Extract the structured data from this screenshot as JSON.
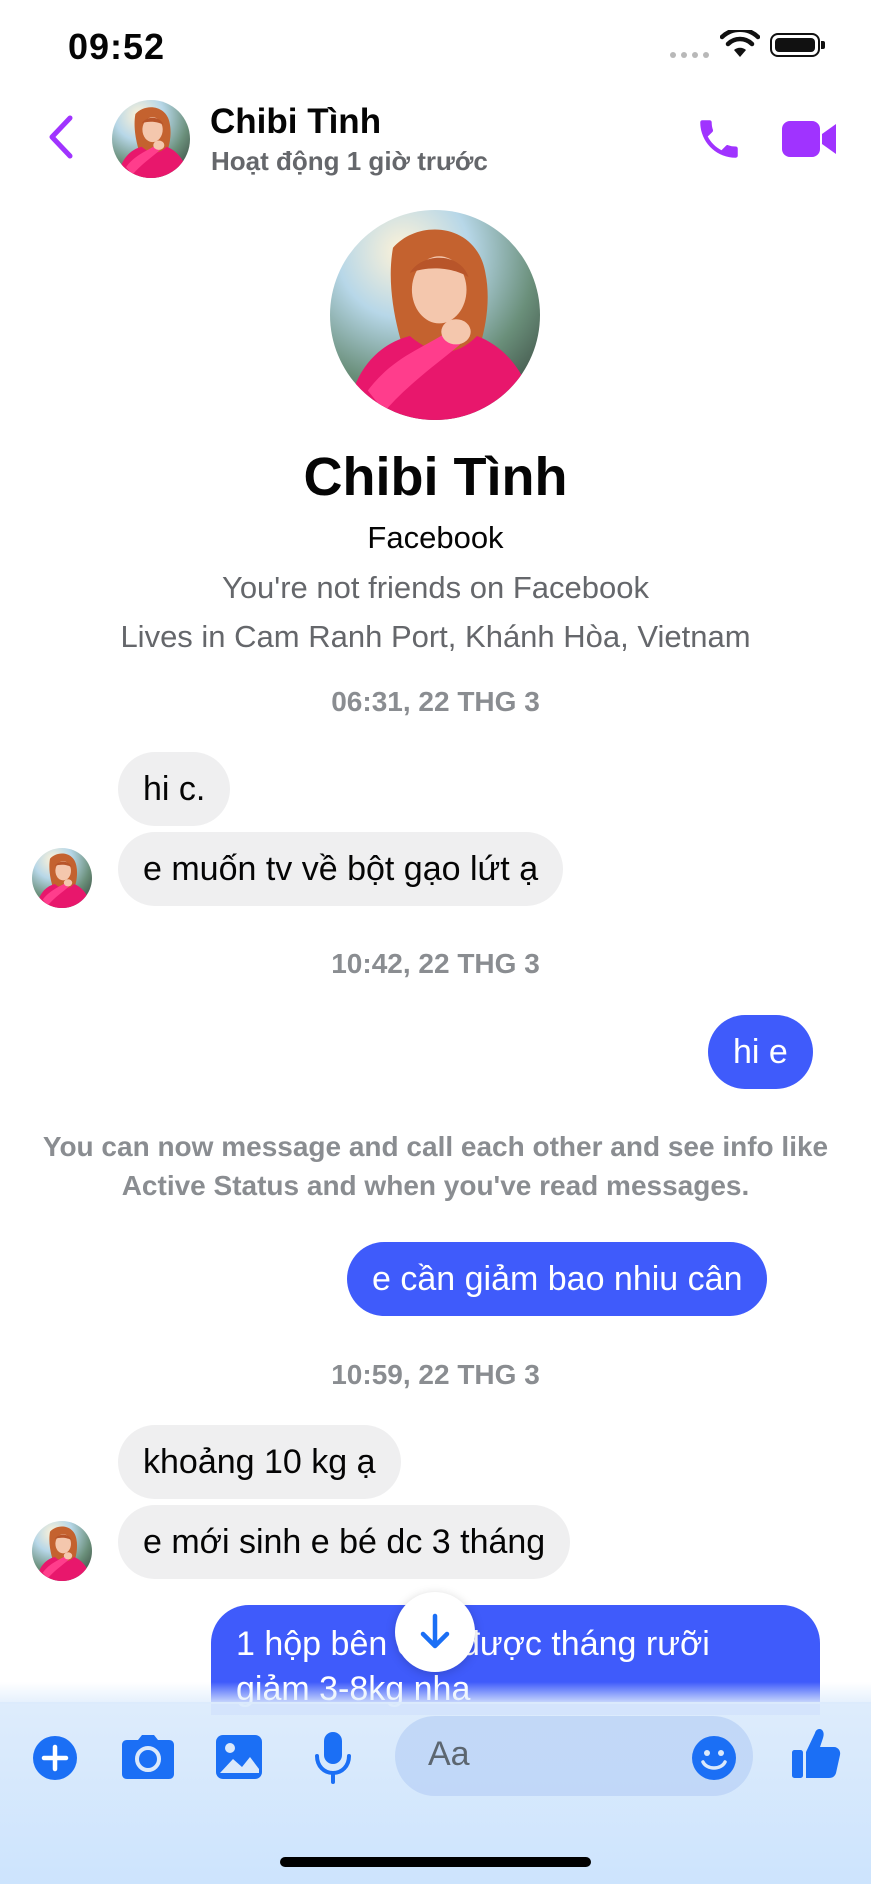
{
  "status_bar": {
    "time": "09:52"
  },
  "header": {
    "name": "Chibi Tình",
    "status": "Hoạt động 1 giờ trước"
  },
  "profile": {
    "name": "Chibi Tình",
    "source": "Facebook",
    "friend_status": "You're not friends on Facebook",
    "lives": "Lives in Cam Ranh Port, Khánh Hòa, Vietnam"
  },
  "timestamps": [
    "06:31, 22 THG 3",
    "10:42, 22 THG 3",
    "10:59, 22 THG 3"
  ],
  "messages": [
    {
      "from": "them",
      "text": "hi c."
    },
    {
      "from": "them",
      "text": "e muốn tv về bột gạo lứt ạ"
    },
    {
      "from": "me",
      "text": "hi e"
    },
    {
      "from": "me",
      "text": "e cần giảm bao nhiu cân"
    },
    {
      "from": "them",
      "text": "khoảng 10 kg ạ"
    },
    {
      "from": "them",
      "text": "e mới sinh e bé dc 3 tháng"
    },
    {
      "from": "me",
      "text": "1 hộp bên c đ. được tháng rưỡi",
      "text2": "giảm 3-8kg nha"
    }
  ],
  "system_message": "You can now message and call each other and see info like Active Status and when you've read messages.",
  "composer": {
    "placeholder": "Aa"
  },
  "colors": {
    "accent": "#a033ff",
    "outgoing_bubble": "#3f5bfb",
    "incoming_bubble": "#efeff0",
    "composer_icons": "#1b6ff5"
  },
  "icons": [
    "back-chevron-icon",
    "phone-icon",
    "video-camera-icon",
    "arrow-down-icon",
    "plus-icon",
    "camera-icon",
    "image-icon",
    "microphone-icon",
    "emoji-icon",
    "thumbs-up-icon"
  ]
}
